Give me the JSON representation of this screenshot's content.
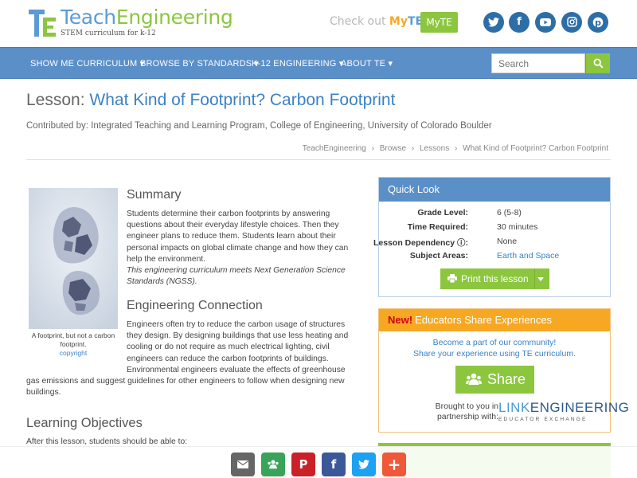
{
  "brand": {
    "teach": "Teach",
    "engineering": "Engineering",
    "tagline": "STEM curriculum for k-12"
  },
  "header": {
    "checkout_prefix": "Check out",
    "checkout_my": "My",
    "checkout_te": "TE",
    "myte_button": "MyTE",
    "social_icons": [
      "twitter-icon",
      "facebook-icon",
      "youtube-icon",
      "instagram-icon",
      "pinterest-icon"
    ]
  },
  "nav": {
    "items": [
      {
        "label": "SHOW ME CURRICULUM ▾"
      },
      {
        "label": "BROWSE BY STANDARDS ▾"
      },
      {
        "label": "K-12 ENGINEERING ▾"
      },
      {
        "label": "ABOUT TE ▾"
      }
    ],
    "search_placeholder": "Search"
  },
  "lesson": {
    "label": "Lesson:",
    "title": "What Kind of Footprint? Carbon Footprint",
    "contributed": "Contributed by: Integrated Teaching and Learning Program, College of Engineering, University of Colorado Boulder"
  },
  "breadcrumbs": [
    "TeachEngineering",
    "›",
    "Browse",
    "›",
    "Lessons",
    "›",
    "What Kind of Footprint? Carbon Footprint"
  ],
  "image": {
    "caption": "A footprint, but not a carbon footprint.",
    "copyright": "copyright"
  },
  "summary": {
    "heading": "Summary",
    "lines": [
      "Students determine their carbon footprints by answering",
      "questions about their everyday lifestyle choices. Then they",
      "engineer plans to reduce them. Students learn about their",
      "personal impacts on global climate change and how they can",
      "help the environment."
    ],
    "ngss_lines": [
      "This engineering curriculum meets Next Generation Science",
      "Standards (NGSS)."
    ]
  },
  "engineering": {
    "heading": "Engineering Connection",
    "lines": [
      "Engineers often try to reduce the carbon usage of structures",
      "they design. By designing buildings that use less heating and",
      "cooling or do not require as much electrical lighting, civil",
      "engineers can reduce the carbon footprints of buildings.",
      "Environmental engineers evaluate the effects of greenhouse",
      "gas emissions and suggest guidelines for other engineers to follow when designing new",
      "buildings."
    ]
  },
  "objectives": {
    "heading": "Learning Objectives",
    "intro": "After this lesson, students should be able to:"
  },
  "quick_look": {
    "heading": "Quick Look",
    "rows": [
      {
        "k": "Grade Level:",
        "v": "6 (5-8)"
      },
      {
        "k": "Time Required:",
        "v": "30 minutes"
      },
      {
        "k": "Lesson Dependency ⓘ:",
        "v": "None"
      },
      {
        "k": "Subject Areas:",
        "v": "Earth and Space"
      }
    ],
    "print_label": "Print this lesson"
  },
  "educators": {
    "new": "New!",
    "heading": "Educators Share Experiences",
    "line1": "Become a part of our community!",
    "line2": "Share your experience using TE curriculum.",
    "share": "Share",
    "brought1": "Brought to you in",
    "brought2": "partnership with:",
    "le_link": "LINK",
    "le_eng": "ENGINEERING",
    "le_sub": "EDUCATOR EXCHANGE"
  },
  "share_bar": {
    "buttons": [
      {
        "icon": "email-icon",
        "color": "#666666"
      },
      {
        "icon": "share-community-icon",
        "color": "#3aa35a"
      },
      {
        "icon": "pinterest-icon",
        "color": "#cb2027"
      },
      {
        "icon": "facebook-icon",
        "color": "#3b5998"
      },
      {
        "icon": "twitter-icon",
        "color": "#1da1f2"
      },
      {
        "icon": "plus-icon",
        "color": "#f0583a"
      }
    ]
  },
  "colors": {
    "brand_blue": "#5b8fc8",
    "brand_green": "#8cc63f",
    "brand_orange": "#f7a823",
    "social_blue": "#2e6ea6"
  }
}
